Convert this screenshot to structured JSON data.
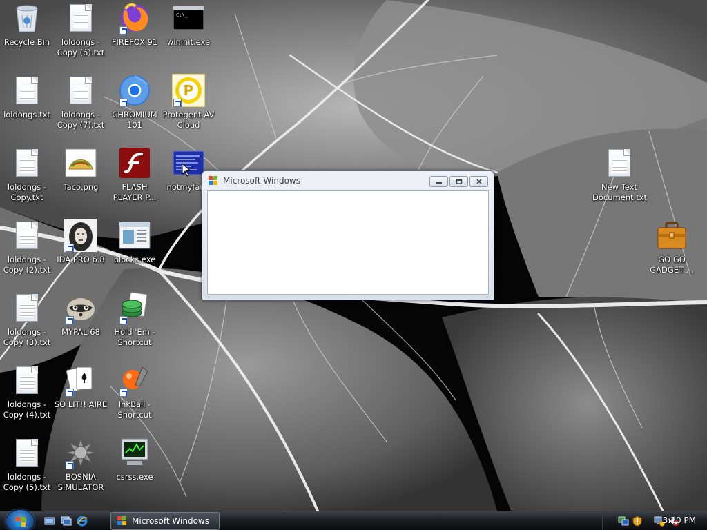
{
  "desktop": {
    "icons": [
      {
        "name": "recycle-bin",
        "label": "Recycle Bin",
        "shortcut": false
      },
      {
        "name": "loldongs-copy-6",
        "label": "loldongs -\nCopy (6).txt",
        "shortcut": false
      },
      {
        "name": "firefox-91",
        "label": "FIREFOX 91",
        "shortcut": true
      },
      {
        "name": "wininit-exe",
        "label": "wininit.exe",
        "shortcut": false
      },
      {
        "name": "loldongs-txt",
        "label": "loldongs.txt",
        "shortcut": false
      },
      {
        "name": "loldongs-copy-7",
        "label": "loldongs -\nCopy (7).txt",
        "shortcut": false
      },
      {
        "name": "chromium-101",
        "label": "CHROMIUM\n101",
        "shortcut": true
      },
      {
        "name": "protegent-av-cloud",
        "label": "Protegent  AV\nCloud",
        "shortcut": true
      },
      {
        "name": "loldongs-copy",
        "label": "loldongs -\nCopy.txt",
        "shortcut": false
      },
      {
        "name": "taco-png",
        "label": "Taco.png",
        "shortcut": false
      },
      {
        "name": "flash-player",
        "label": "FLASH\nPLAYER P...",
        "shortcut": false
      },
      {
        "name": "notmyfault",
        "label": "notmyfault",
        "shortcut": false
      },
      {
        "name": "loldongs-copy-2",
        "label": "loldongs -\nCopy (2).txt",
        "shortcut": false
      },
      {
        "name": "ida-pro",
        "label": "IDA PRO 6.8",
        "shortcut": true
      },
      {
        "name": "blocks-exe",
        "label": "blocks.exe",
        "shortcut": false
      },
      {
        "name": "loldongs-copy-3",
        "label": "loldongs -\nCopy (3).txt",
        "shortcut": false
      },
      {
        "name": "mypal-68",
        "label": "MYPAL 68",
        "shortcut": true
      },
      {
        "name": "hold-em-shortcut",
        "label": "Hold 'Em -\nShortcut",
        "shortcut": true
      },
      {
        "name": "loldongs-copy-4",
        "label": "loldongs -\nCopy (4).txt",
        "shortcut": false
      },
      {
        "name": "so-lit-aire",
        "label": "SO LIT!! AIRE",
        "shortcut": true
      },
      {
        "name": "inkball-shortcut",
        "label": "InkBall -\nShortcut",
        "shortcut": true
      },
      {
        "name": "loldongs-copy-5",
        "label": "loldongs -\nCopy (5).txt",
        "shortcut": false
      },
      {
        "name": "bosnia-simulator",
        "label": "BOSNIA\nSIMULATOR",
        "shortcut": true
      },
      {
        "name": "csrss-exe",
        "label": "csrss.exe",
        "shortcut": false
      },
      {
        "name": "new-text-document",
        "label": "New Text\nDocument.txt",
        "shortcut": false
      },
      {
        "name": "go-go-gadget",
        "label": "GO GO\nGADGET ...",
        "shortcut": false
      }
    ]
  },
  "window": {
    "title": "Microsoft Windows",
    "buttons": {
      "minimize": "minimize-icon",
      "restore": "restore-icon",
      "close": "close-icon"
    }
  },
  "taskbar": {
    "quick_launch": [
      "show-desktop-icon",
      "switch-windows-icon",
      "internet-explorer-icon"
    ],
    "active_task": "Microsoft Windows",
    "tray_icons": [
      "network-icon",
      "security-alert-icon",
      "network-status-icon",
      "volume-muted-icon"
    ],
    "clock": "3:20 PM"
  }
}
